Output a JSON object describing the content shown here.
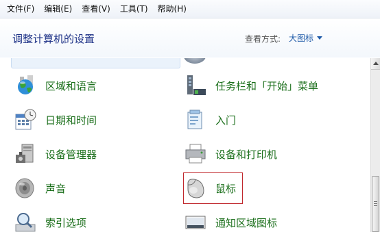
{
  "menubar": {
    "items": [
      {
        "label": "文件(F)"
      },
      {
        "label": "编辑(E)"
      },
      {
        "label": "查看(V)"
      },
      {
        "label": "工具(T)"
      },
      {
        "label": "帮助(H)"
      }
    ]
  },
  "header": {
    "title": "调整计算机的设置",
    "view_label": "查看方式:",
    "view_value": "大图标"
  },
  "items": {
    "region": {
      "label": "区域和语言",
      "icon": "globe-icon"
    },
    "taskbar": {
      "label": "任务栏和「开始」菜单",
      "icon": "taskbar-icon"
    },
    "datetime": {
      "label": "日期和时间",
      "icon": "calendar-clock-icon"
    },
    "getting_started": {
      "label": "入门",
      "icon": "getting-started-icon"
    },
    "device_manager": {
      "label": "设备管理器",
      "icon": "device-manager-icon"
    },
    "devices_printers": {
      "label": "设备和打印机",
      "icon": "printer-icon"
    },
    "sound": {
      "label": "声音",
      "icon": "speaker-icon"
    },
    "mouse": {
      "label": "鼠标",
      "icon": "mouse-icon"
    },
    "indexing": {
      "label": "索引选项",
      "icon": "magnifier-icon"
    },
    "notification": {
      "label": "通知区域图标",
      "icon": "notification-area-icon"
    }
  },
  "colors": {
    "link_green": "#1b6f1b",
    "title_blue": "#1e3287",
    "highlight_red": "#c0282d"
  }
}
